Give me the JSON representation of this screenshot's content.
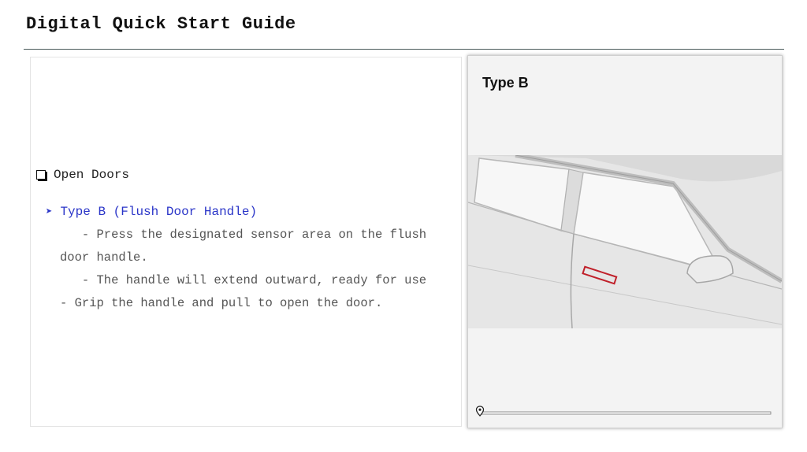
{
  "header": {
    "title": "Digital Quick Start Guide"
  },
  "content": {
    "section_label": "Open Doors",
    "subsection_label": "Type B (Flush Door Handle)",
    "lines": [
      "   - Press the designated sensor area on the flush",
      "door handle.",
      "   - The handle will extend outward, ready for use",
      "- Grip the handle and pull to open the door."
    ]
  },
  "video_panel": {
    "title": "Type B",
    "progress": 0.0
  },
  "colors": {
    "accent_blue": "#2a35c8",
    "handle_highlight": "#c0202a",
    "rule": "#4a5a5a"
  },
  "icons": [
    "checkbox-icon",
    "arrow-bullet-icon",
    "location-pin-icon"
  ]
}
